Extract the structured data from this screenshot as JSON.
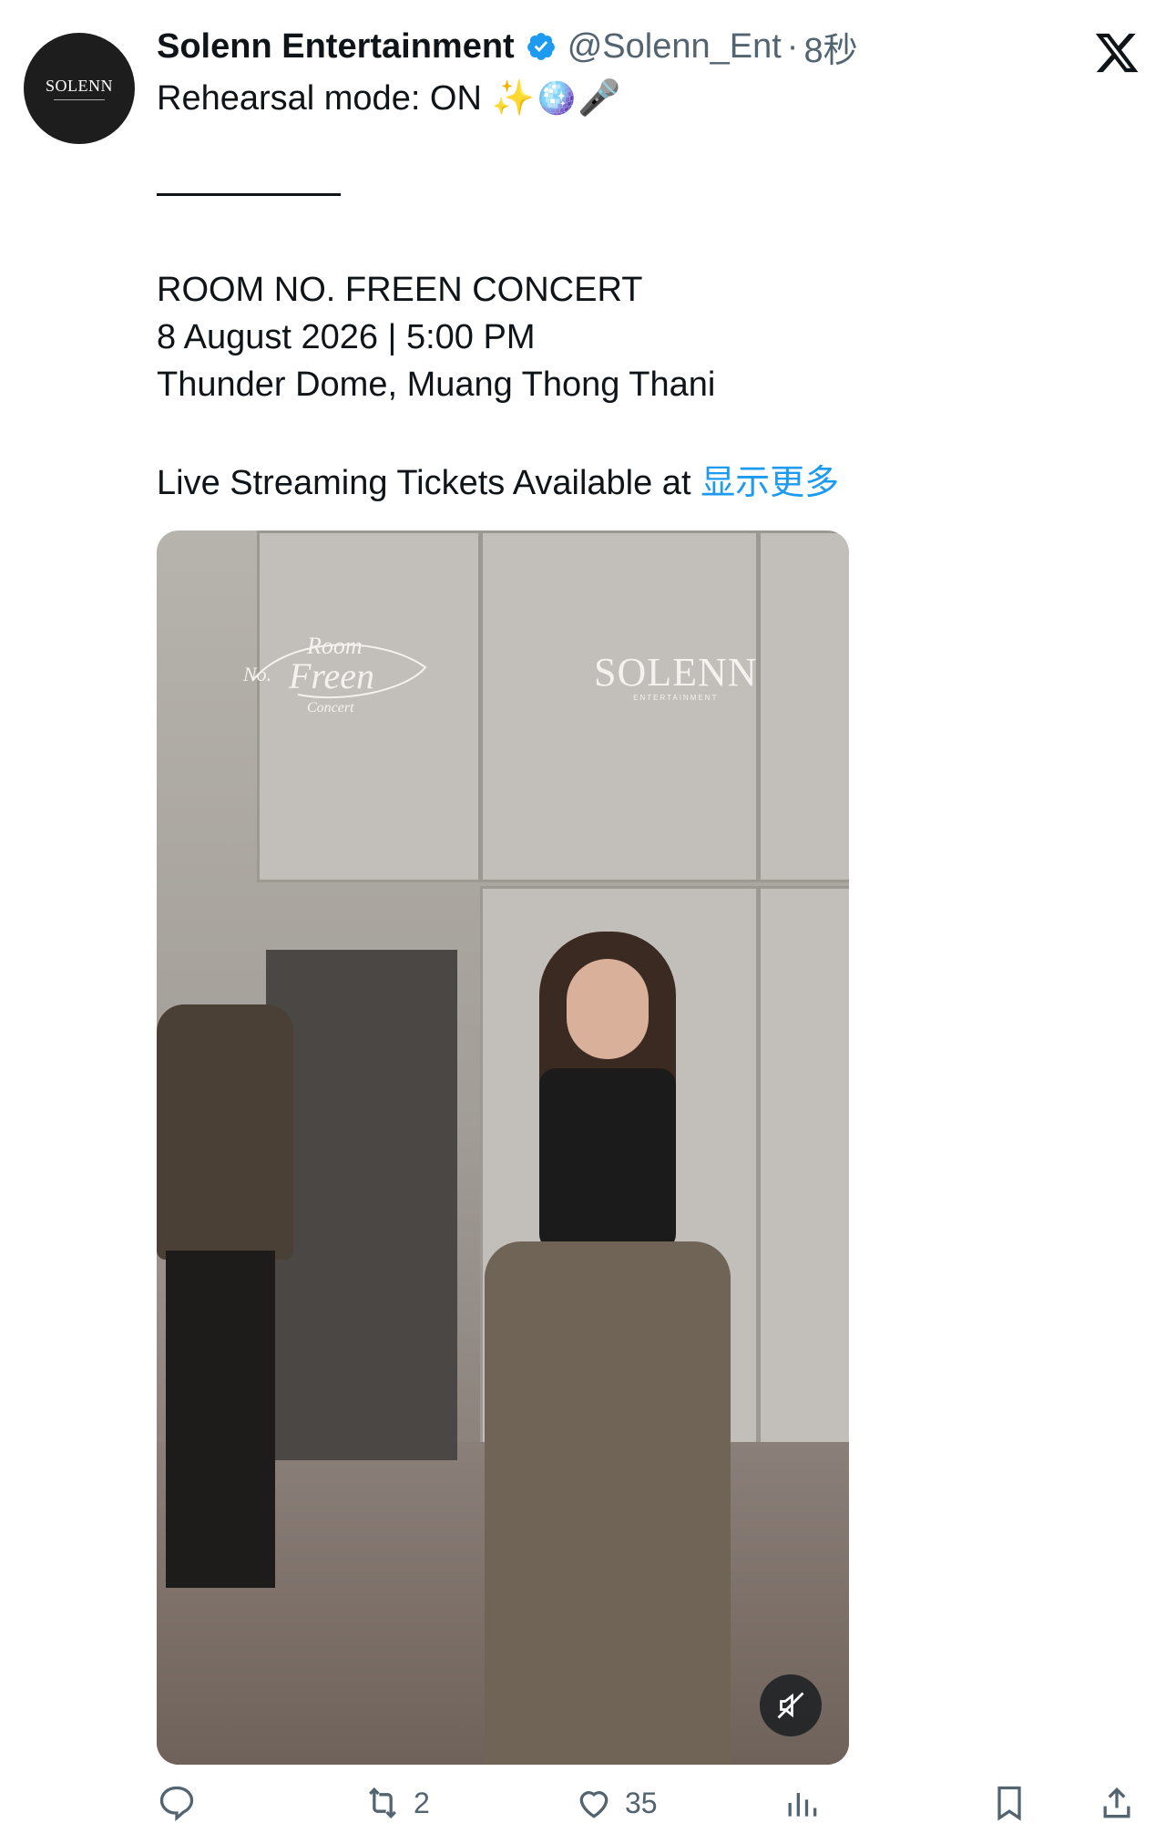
{
  "author": {
    "display_name": "Solenn Entertainment",
    "handle": "@Solenn_Ent",
    "time": "8秒",
    "avatar_text": "SOLENN",
    "verified_color": "#1d9bf0"
  },
  "tweet": {
    "line1": "Rehearsal mode: ON ✨🪩🎤",
    "line2": "ROOM NO. FREEN CONCERT",
    "line3": "8 August 2026 | 5:00 PM",
    "line4": "Thunder Dome, Muang Thong Thani",
    "line5": "Live Streaming Tickets Available at ",
    "show_more": "显示更多"
  },
  "media": {
    "watermark_left": "Room No. Freen Concert",
    "watermark_right": "SOLENN",
    "watermark_right_sub": "ENTERTAINMENT",
    "mute_icon": "speaker-muted-icon"
  },
  "actions": {
    "reply_count": "",
    "retweet_count": "2",
    "like_count": "35",
    "views_count": "",
    "icons": [
      "reply-icon",
      "retweet-icon",
      "like-icon",
      "views-icon",
      "bookmark-icon",
      "share-icon"
    ]
  },
  "colors": {
    "text": "#0f1419",
    "secondary": "#536471",
    "link": "#1d9bf0",
    "background": "#ffffff"
  }
}
